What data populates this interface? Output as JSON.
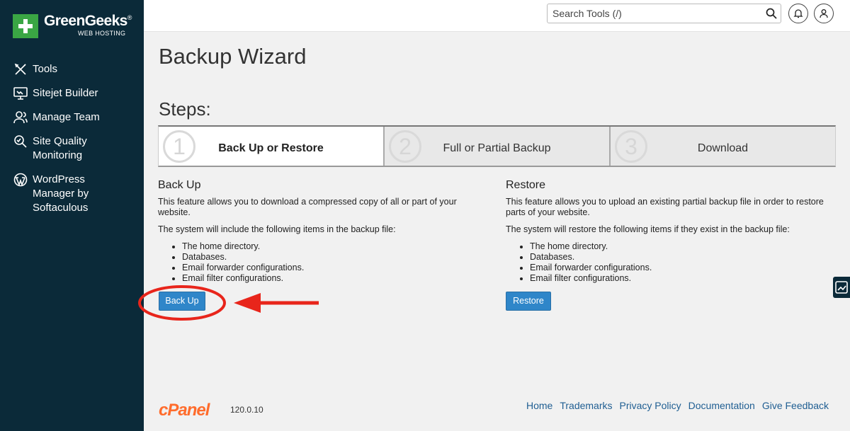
{
  "brand": {
    "name": "GreenGeeks",
    "reg": "®",
    "sub": "WEB HOSTING",
    "accent": "#3aa644"
  },
  "sidebar": {
    "items": [
      {
        "label": "Tools",
        "icon": "tools-icon"
      },
      {
        "label": "Sitejet Builder",
        "icon": "monitor-icon"
      },
      {
        "label": "Manage Team",
        "icon": "team-icon"
      },
      {
        "label": "Site Quality Monitoring",
        "icon": "magnifier-icon"
      },
      {
        "label": "WordPress Manager by Softaculous",
        "icon": "wordpress-icon"
      }
    ]
  },
  "header": {
    "search_placeholder": "Search Tools (/)"
  },
  "page": {
    "title": "Backup Wizard",
    "steps_label": "Steps:"
  },
  "steps": [
    {
      "num": "1",
      "label": "Back Up or Restore"
    },
    {
      "num": "2",
      "label": "Full or Partial Backup"
    },
    {
      "num": "3",
      "label": "Download"
    }
  ],
  "backup": {
    "heading": "Back Up",
    "desc": "This feature allows you to download a compressed copy of all or part of your website.",
    "intro": "The system will include the following items in the backup file:",
    "items": [
      "The home directory.",
      "Databases.",
      "Email forwarder configurations.",
      "Email filter configurations."
    ],
    "button": "Back Up"
  },
  "restore": {
    "heading": "Restore",
    "desc": "This feature allows you to upload an existing partial backup file in order to restore parts of your website.",
    "intro": "The system will restore the following items if they exist in the backup file:",
    "items": [
      "The home directory.",
      "Databases.",
      "Email forwarder configurations.",
      "Email filter configurations."
    ],
    "button": "Restore"
  },
  "footer": {
    "logo": "cPanel",
    "version": "120.0.10",
    "links": [
      "Home",
      "Trademarks",
      "Privacy Policy",
      "Documentation",
      "Give Feedback"
    ]
  },
  "colors": {
    "sidebar": "#0b2a39",
    "button": "#2f86c9",
    "annotation": "#e8251b",
    "cpanel": "#ff6c2c"
  }
}
